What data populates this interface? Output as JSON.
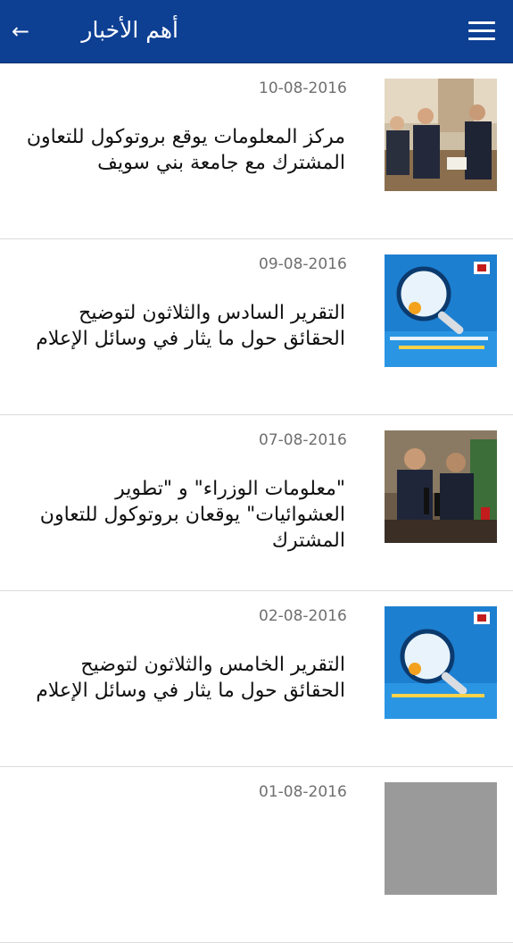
{
  "app_bar": {
    "title": "أهم الأخبار",
    "menu_icon": "hamburger-menu-icon",
    "back_icon": "arrow-left-icon",
    "back_glyph": "←",
    "color": "#0d3f93"
  },
  "news": [
    {
      "date": "10-08-2016",
      "title": "مركز المعلومات يوقع بروتوكول للتعاون المشترك مع جامعة بني سويف",
      "thumbnail": "meeting-photo"
    },
    {
      "date": "09-08-2016",
      "title": "التقرير السادس والثلاثون لتوضيح الحقائق حول ما يثار في وسائل الإعلام",
      "thumbnail": "truth-report-graphic"
    },
    {
      "date": "07-08-2016",
      "title": "\"معلومات الوزراء\" و \"تطوير العشوائيات\" يوقعان بروتوكول للتعاون المشترك",
      "thumbnail": "press-conference-photo"
    },
    {
      "date": "02-08-2016",
      "title": "التقرير الخامس والثلاثون لتوضيح الحقائق  حول ما يثار في وسائل الإعلام",
      "thumbnail": "truth-report-graphic"
    },
    {
      "date": "01-08-2016",
      "title": "",
      "thumbnail": "photo"
    }
  ]
}
